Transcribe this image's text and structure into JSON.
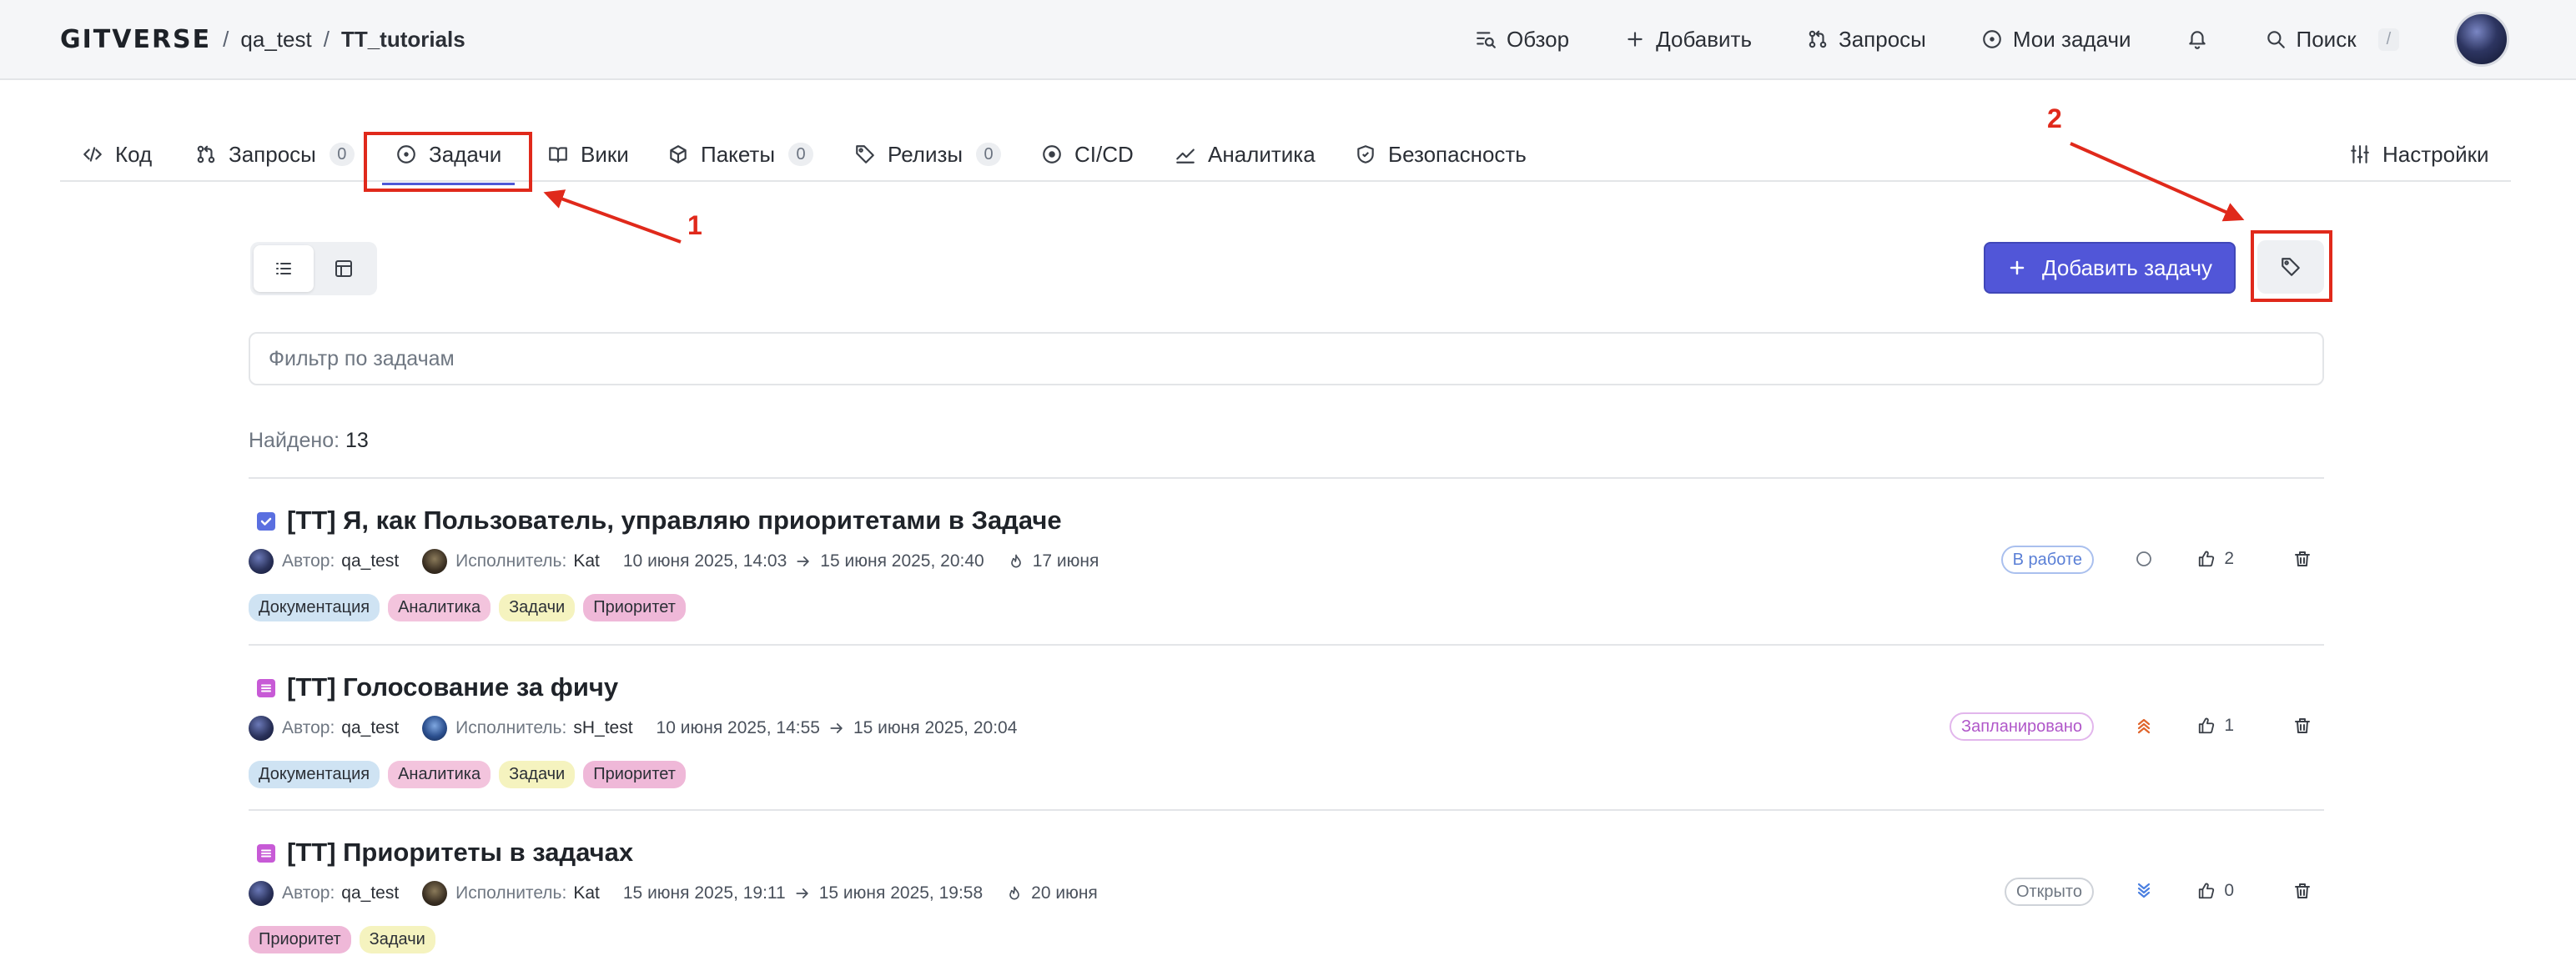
{
  "header": {
    "logo": "GITVERSE",
    "owner": "qa_test",
    "repo": "TT_tutorials",
    "separator": "/",
    "nav": {
      "overview": "Обзор",
      "add": "Добавить",
      "requests": "Запросы",
      "my_tasks": "Мои задачи",
      "search": "Поиск",
      "search_kbd": "/"
    }
  },
  "tabs": {
    "code": "Код",
    "requests": "Запросы",
    "requests_count": "0",
    "tasks": "Задачи",
    "wiki": "Вики",
    "packages": "Пакеты",
    "packages_count": "0",
    "releases": "Релизы",
    "releases_count": "0",
    "cicd": "CI/CD",
    "analytics": "Аналитика",
    "security": "Безопасность",
    "settings": "Настройки"
  },
  "toolbar": {
    "add_task": "Добавить задачу",
    "filter_placeholder": "Фильтр по задачам"
  },
  "found": {
    "label": "Найдено:",
    "count": "13"
  },
  "meta_labels": {
    "author": "Автор:",
    "assignee": "Исполнитель:"
  },
  "issues": [
    {
      "title": "[TT] Я, как Пользователь, управляю приоритетами в Задаче",
      "author": "qa_test",
      "assignee": "Kat",
      "start": "10 июня 2025, 14:03",
      "end": "15 июня 2025, 20:40",
      "due": "17 июня",
      "status": "В работе",
      "likes": "2",
      "tags": [
        "Документация",
        "Аналитика",
        "Задачи",
        "Приоритет"
      ]
    },
    {
      "title": "[TT] Голосование за фичу",
      "author": "qa_test",
      "assignee": "sH_test",
      "start": "10 июня 2025, 14:55",
      "end": "15 июня 2025, 20:04",
      "status": "Запланировано",
      "likes": "1",
      "tags": [
        "Документация",
        "Аналитика",
        "Задачи",
        "Приоритет"
      ]
    },
    {
      "title": "[TT] Приоритеты в задачах",
      "author": "qa_test",
      "assignee": "Kat",
      "start": "15 июня 2025, 19:11",
      "end": "15 июня 2025, 19:58",
      "due": "20 июня",
      "status": "Открыто",
      "likes": "0",
      "tags": [
        "Приоритет",
        "Задачи"
      ]
    }
  ],
  "annotations": {
    "one": "1",
    "two": "2"
  },
  "colors": {
    "accent": "#5156d8",
    "annotation": "#e0291b",
    "status_in_work": "#5a7fd6",
    "status_planned": "#b057c9",
    "status_open": "#6f7782"
  }
}
